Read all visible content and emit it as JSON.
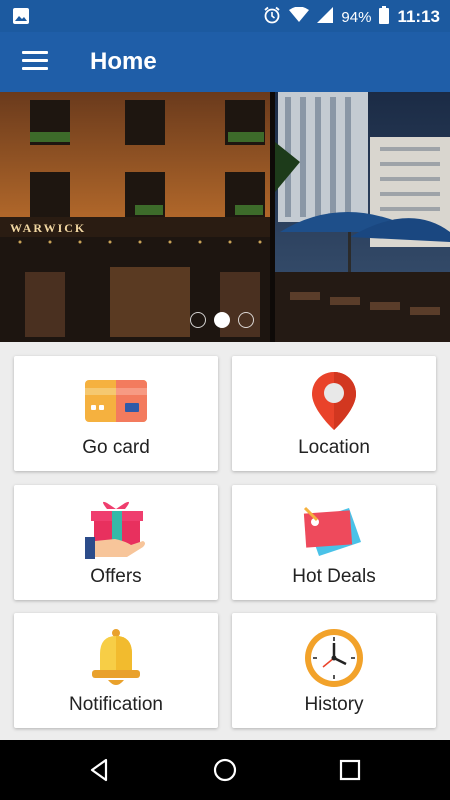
{
  "status_bar": {
    "battery": "94%",
    "time": "11:13",
    "icons": [
      "image-icon",
      "alarm-icon",
      "wifi-icon",
      "signal-icon",
      "battery-icon"
    ]
  },
  "app_bar": {
    "title": "Home",
    "menu_icon": "hamburger-menu-icon",
    "color": "#1f5ea8"
  },
  "banner": {
    "sign_text": "WARWICK",
    "slide_count": 3,
    "active_slide": 2
  },
  "tiles": [
    {
      "label": "Go card",
      "icon": "credit-card-icon"
    },
    {
      "label": "Location",
      "icon": "map-pin-icon"
    },
    {
      "label": "Offers",
      "icon": "gift-icon"
    },
    {
      "label": "Hot Deals",
      "icon": "price-tag-icon"
    },
    {
      "label": "Notification",
      "icon": "bell-icon"
    },
    {
      "label": "History",
      "icon": "clock-icon"
    }
  ],
  "nav_bar": {
    "buttons": [
      "back-icon",
      "home-icon",
      "recents-icon"
    ]
  }
}
